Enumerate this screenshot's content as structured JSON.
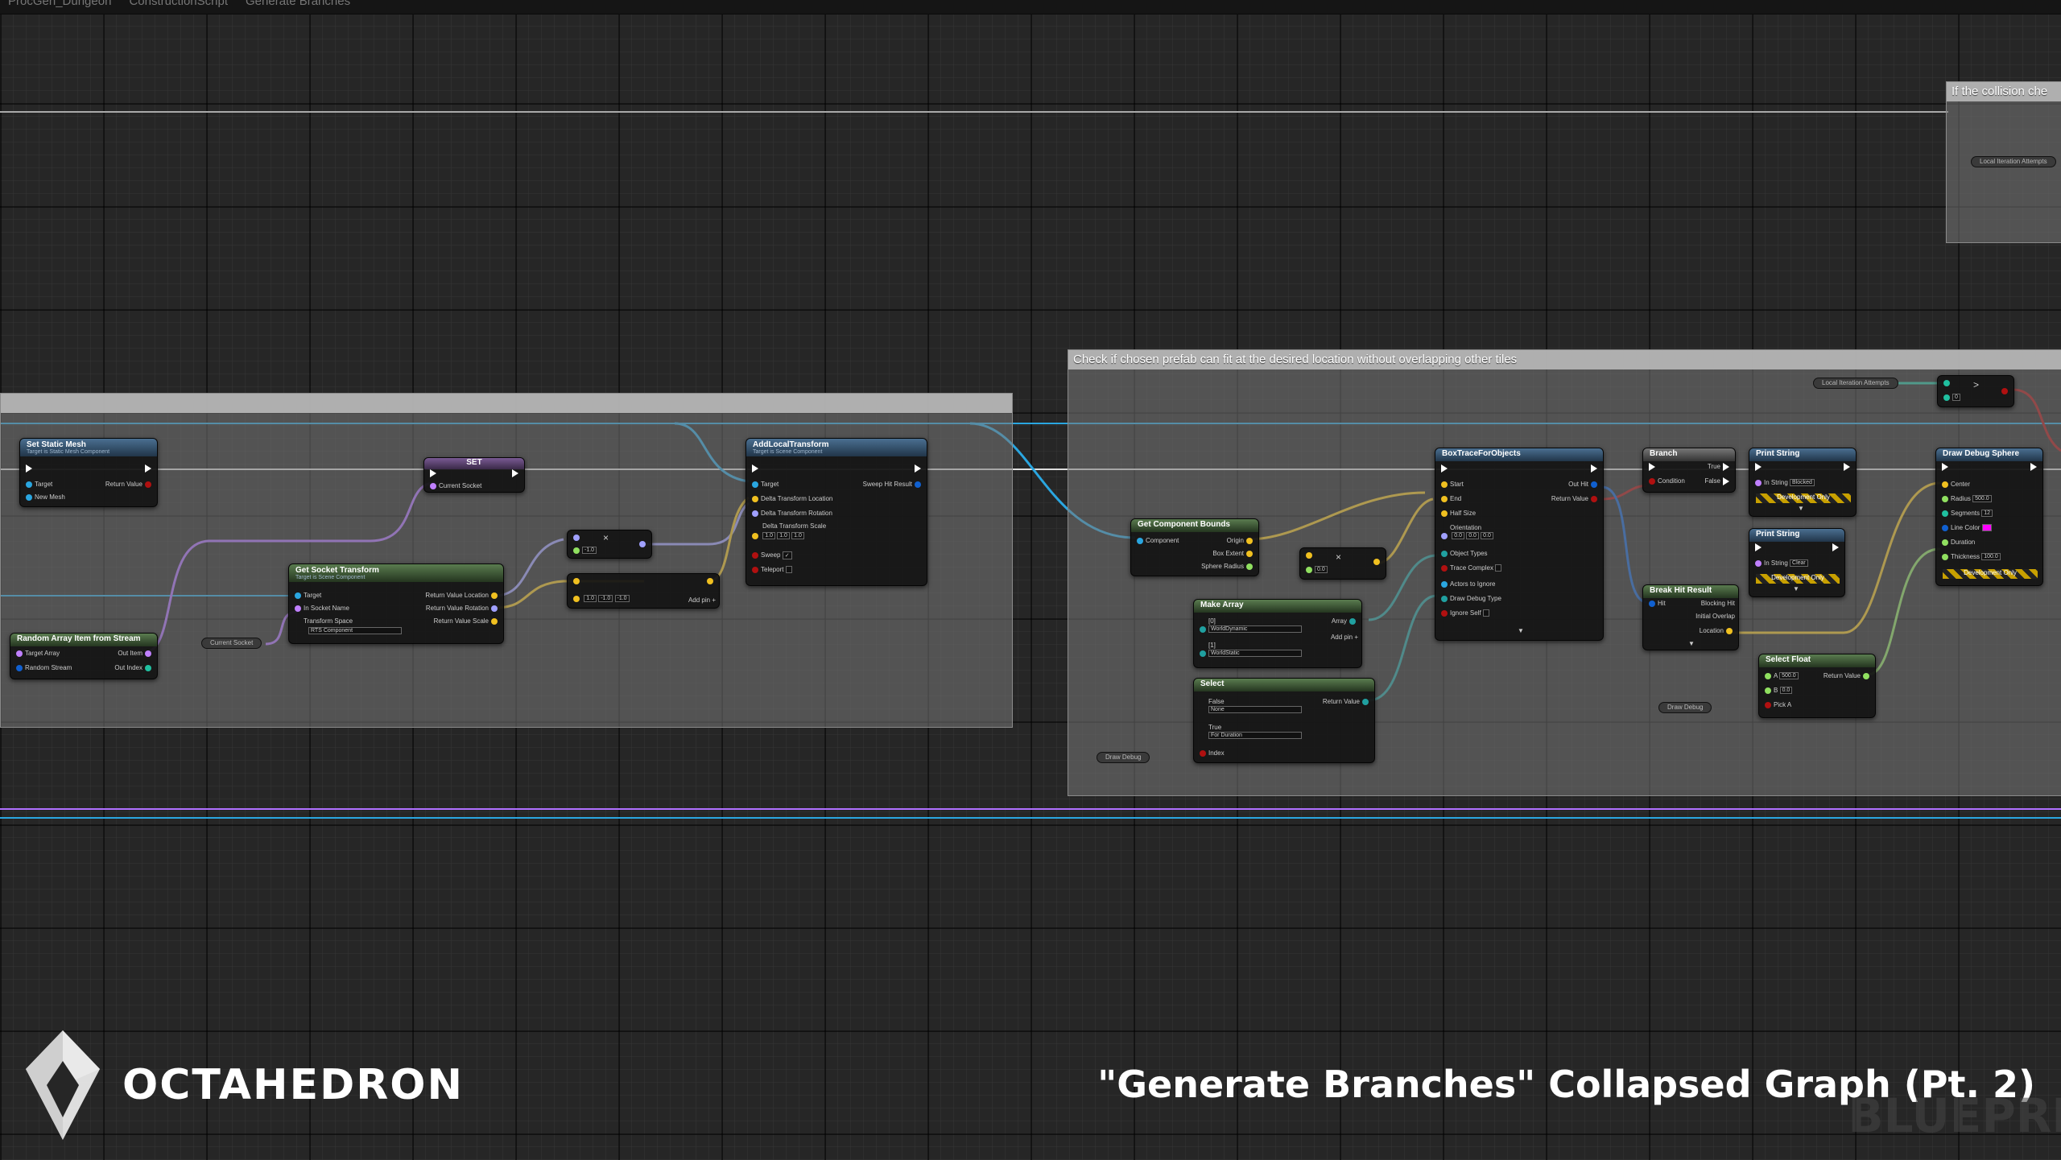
{
  "topbar": {
    "items": [
      "ProcGen_Dungeon",
      "ConstructionScript",
      "Generate Branches"
    ]
  },
  "comments": {
    "left": "",
    "middle": "Check if chosen prefab can fit at the desired location without overlapping other tiles",
    "right": "If the collision che"
  },
  "nodes": {
    "set_static_mesh": {
      "title": "Set Static Mesh",
      "subtitle": "Target is Static Mesh Component",
      "pins": [
        "Target",
        "New Mesh",
        "Return Value"
      ]
    },
    "set_var": {
      "title": "SET",
      "pins": [
        "Current Socket"
      ]
    },
    "random_array": {
      "title": "Random Array Item from Stream",
      "pins": [
        "Target Array",
        "Random Stream",
        "Out Item",
        "Out Index"
      ]
    },
    "current_socket_ref": {
      "label": "Current Socket"
    },
    "get_socket_transform": {
      "title": "Get Socket Transform",
      "subtitle": "Target is Scene Component",
      "pins": [
        "Target",
        "In Socket Name",
        "Transform Space",
        "Return Value Location",
        "Return Value Rotation",
        "Return Value Scale"
      ],
      "transform_space": "RTS Component"
    },
    "multiply_1": {
      "value": "-1.0"
    },
    "make_vector": {
      "x": "1.0",
      "y": "-1.0",
      "z": "-1.0",
      "add_pin": "Add pin"
    },
    "add_local_transform": {
      "title": "AddLocalTransform",
      "subtitle": "Target is Scene Component",
      "pins": [
        "Target",
        "Delta Transform Location",
        "Delta Transform Rotation",
        "Delta Transform Scale",
        "Sweep",
        "Teleport",
        "Sweep Hit Result"
      ],
      "scale": [
        "1.0",
        "1.0",
        "1.0"
      ]
    },
    "get_component_bounds": {
      "title": "Get Component Bounds",
      "pins": [
        "Component",
        "Origin",
        "Box Extent",
        "Sphere Radius"
      ]
    },
    "multiply_2": {
      "value": "0.0"
    },
    "make_array": {
      "title": "Make Array",
      "pins": [
        "[0]",
        "[1]",
        "Array",
        "Add pin"
      ],
      "values": [
        "WorldDynamic",
        "WorldStatic"
      ]
    },
    "select": {
      "title": "Select",
      "pins": [
        "False",
        "True",
        "Index",
        "Return Value"
      ],
      "values": [
        "None",
        "For Duration"
      ]
    },
    "draw_debug_ref1": {
      "label": "Draw Debug"
    },
    "box_trace": {
      "title": "BoxTraceForObjects",
      "pins": [
        "Start",
        "End",
        "Half Size",
        "Orientation",
        "Object Types",
        "Trace Complex",
        "Actors to Ignore",
        "Draw Debug Type",
        "Ignore Self",
        "Out Hit",
        "Return Value"
      ],
      "orientation": [
        "0.0",
        "0.0",
        "0.0"
      ]
    },
    "branch": {
      "title": "Branch",
      "pins": [
        "Condition",
        "True",
        "False"
      ]
    },
    "break_hit": {
      "title": "Break Hit Result",
      "pins": [
        "Hit",
        "Blocking Hit",
        "Initial Overlap",
        "Location"
      ]
    },
    "print_string_1": {
      "title": "Print String",
      "pins": [
        "In String"
      ],
      "value": "Blocked",
      "dev": "Development Only"
    },
    "print_string_2": {
      "title": "Print String",
      "pins": [
        "In String"
      ],
      "value": "Clear",
      "dev": "Development Only"
    },
    "select_float": {
      "title": "Select Float",
      "pins": [
        "A",
        "B",
        "Pick A",
        "Return Value"
      ],
      "a": "500.0",
      "b": "0.0"
    },
    "draw_debug_ref2": {
      "label": "Draw Debug"
    },
    "draw_debug_sphere": {
      "title": "Draw Debug Sphere",
      "pins": [
        "Center",
        "Radius",
        "Segments",
        "Line Color",
        "Duration",
        "Thickness"
      ],
      "radius": "500.0",
      "segments": "12",
      "thickness": "100.0",
      "dev": "Development Only"
    },
    "local_iter_ref1": {
      "label": "Local Iteration Attempts"
    },
    "greater": {
      "value": "0"
    },
    "local_iter_ref2": {
      "label": "Local Iteration Attempts"
    }
  },
  "branding": {
    "logo_text": "OCTAHEDRON",
    "caption": "\"Generate Branches\" Collapsed Graph (Pt. 2)",
    "watermark": "BLUEPRI"
  },
  "colors": {
    "exec": "#ffffff",
    "object": "#2aa6e0",
    "vector": "#f0c020",
    "rotator": "#a0a0ff",
    "name": "#c080ff",
    "bool": "#b01010",
    "float": "#90e060",
    "struct": "#1060d0"
  }
}
